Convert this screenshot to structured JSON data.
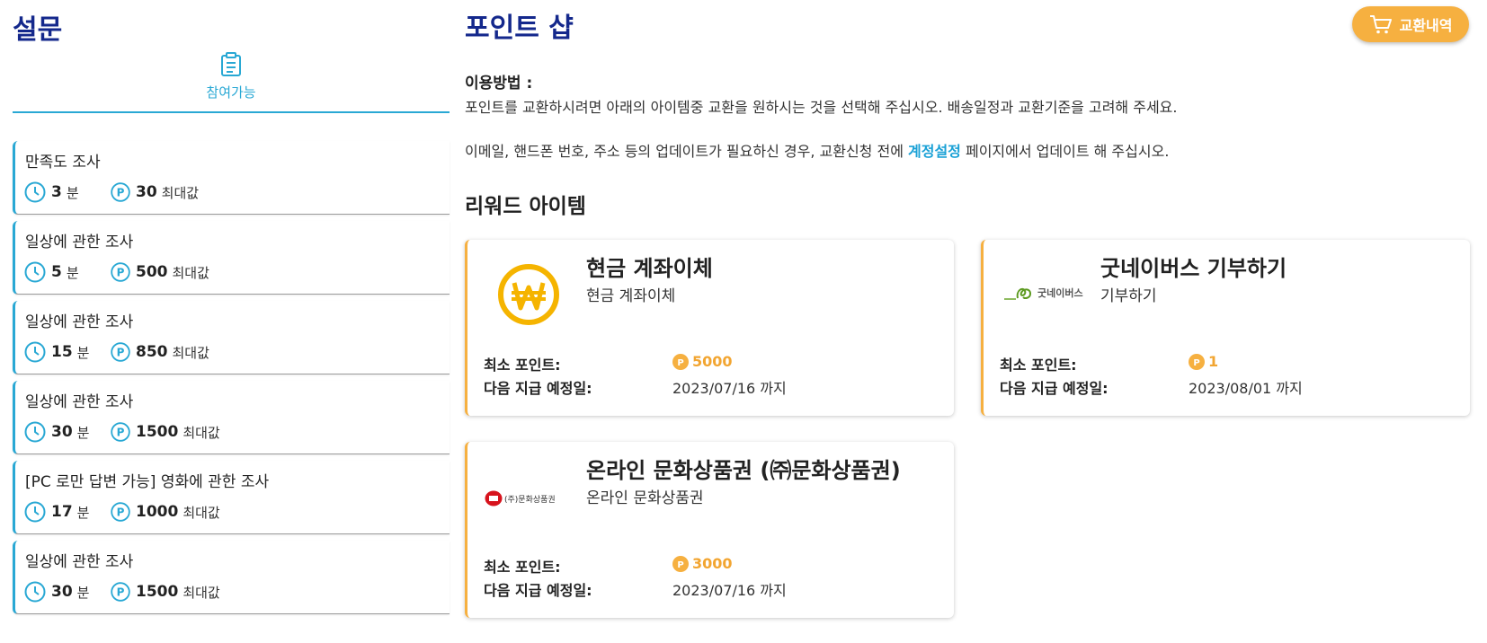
{
  "surveys": {
    "title": "설문",
    "tab_label": "참여가능",
    "minute_unit": "분",
    "max_label": "최대값",
    "items": [
      {
        "title": "만족도 조사",
        "minutes": "3",
        "points": "30"
      },
      {
        "title": "일상에 관한 조사",
        "minutes": "5",
        "points": "500"
      },
      {
        "title": "일상에 관한 조사",
        "minutes": "15",
        "points": "850"
      },
      {
        "title": "일상에 관한 조사",
        "minutes": "30",
        "points": "1500"
      },
      {
        "title": "[PC 로만 답변 가능] 영화에 관한 조사",
        "minutes": "17",
        "points": "1000"
      },
      {
        "title": "일상에 관한 조사",
        "minutes": "30",
        "points": "1500"
      }
    ]
  },
  "shop": {
    "title": "포인트 샵",
    "history_button": "교환내역",
    "howto_label": "이용방법 :",
    "howto_text": "포인트를 교환하시려면 아래의 아이템중 교환을 원하시는 것을 선택해 주십시오. 배송일정과 교환기준을 고려해 주세요.",
    "note_before": "이메일, 핸드폰 번호, 주소 등의 업데이트가 필요하신 경우, 교환신청 전에 ",
    "note_link": "계정설정",
    "note_after": " 페이지에서 업데이트 해 주십시오.",
    "rewards_title": "리워드 아이템",
    "min_points_label": "최소 포인트:",
    "next_payout_label": "다음 지급 예정일:",
    "cards": [
      {
        "name": "현금 계좌이체",
        "subtitle": "현금 계좌이체",
        "min_points": "5000",
        "next_date": "2023/07/16 까지",
        "logo_icon": "won-coin-icon"
      },
      {
        "name": "굿네이버스 기부하기",
        "subtitle": "기부하기",
        "logo_text": "굿네이버스",
        "min_points": "1",
        "next_date": "2023/08/01 까지",
        "logo_icon": "goodneighbors-logo"
      },
      {
        "name": "온라인 문화상품권 (㈜문화상품권)",
        "subtitle": "온라인 문화상품권",
        "logo_text": "(주)문화상품권",
        "min_points": "3000",
        "next_date": "2023/07/16 까지",
        "logo_icon": "culture-gift-logo"
      }
    ]
  },
  "colors": {
    "title_blue": "#14288c",
    "accent_cyan": "#29a8d4",
    "accent_orange": "#f6b040",
    "link_blue": "#1aa1d6"
  }
}
